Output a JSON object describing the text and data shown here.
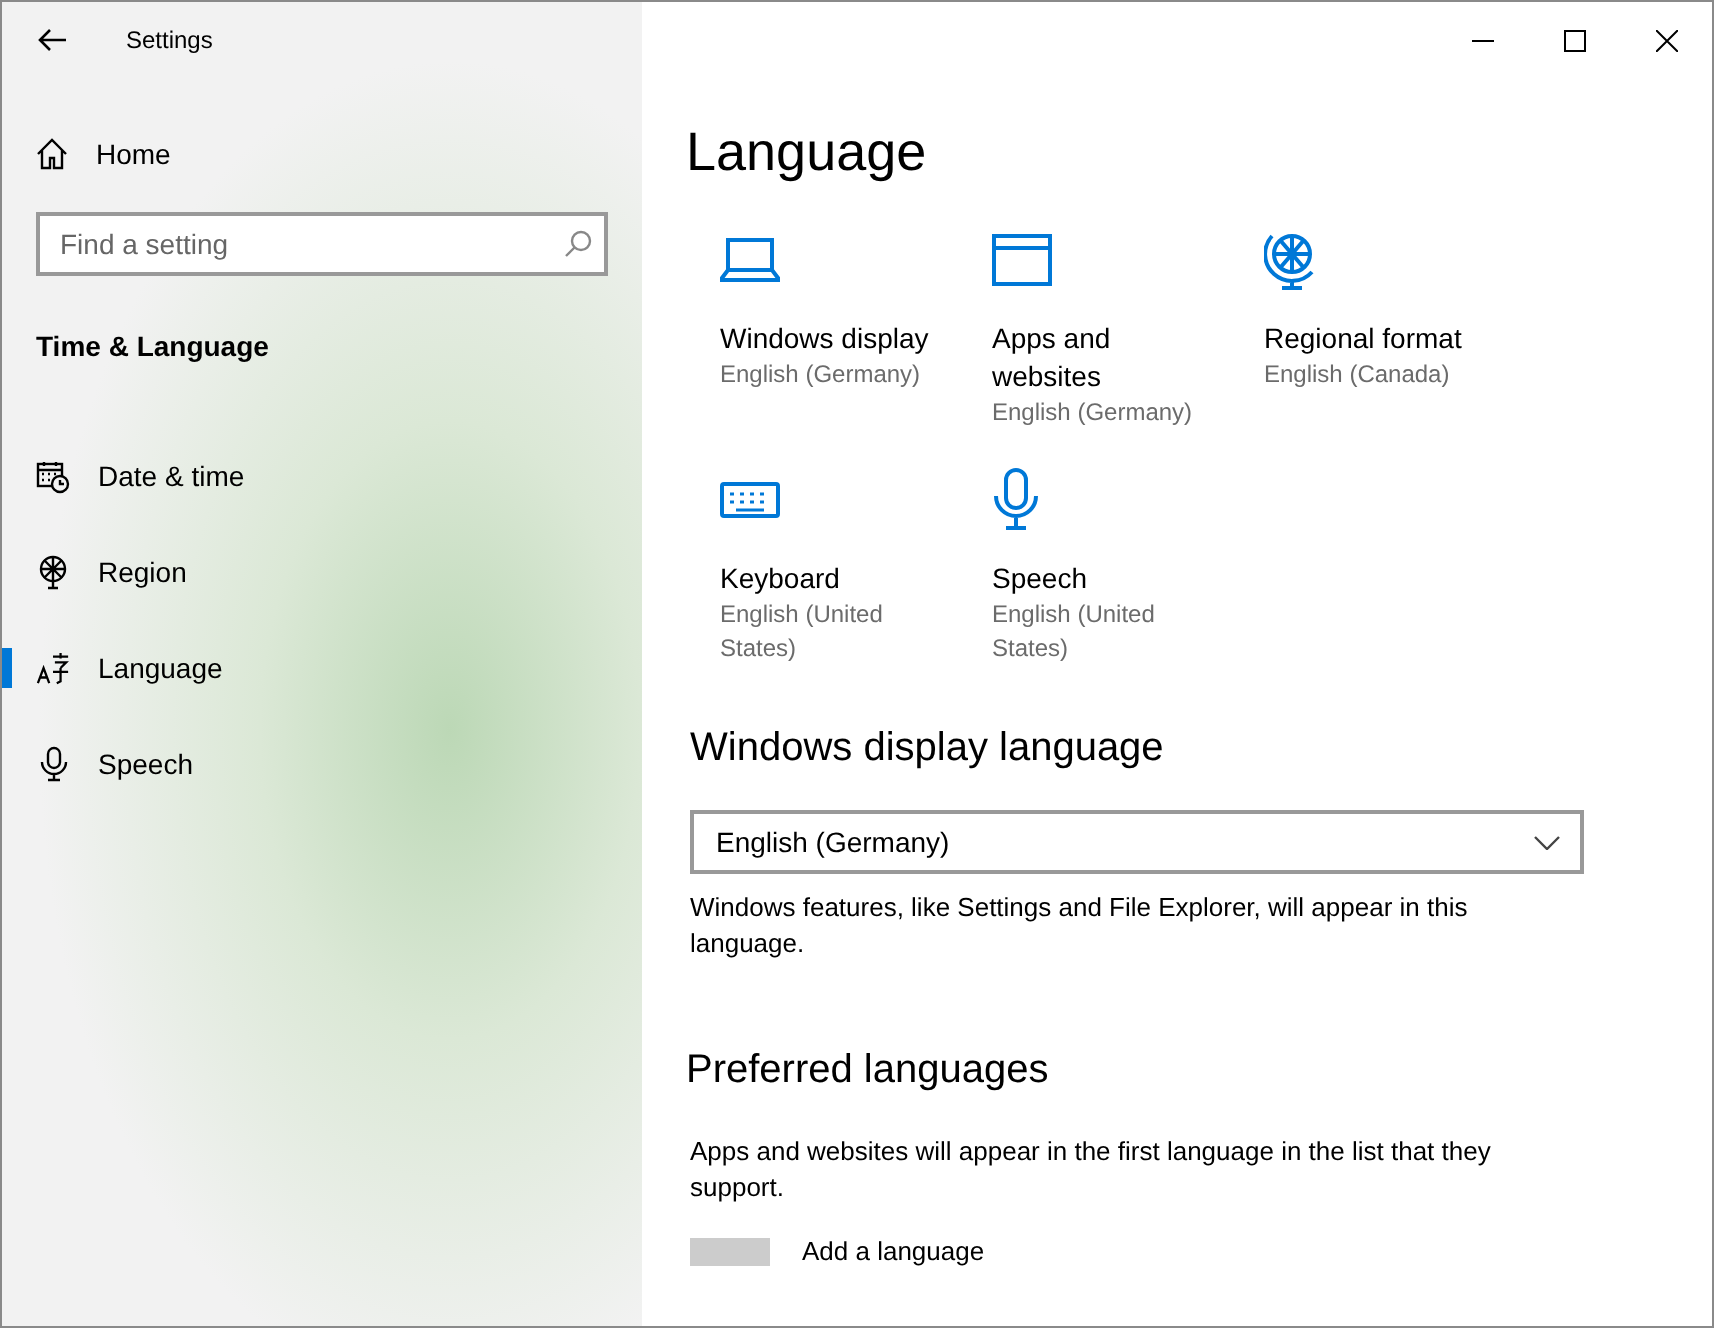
{
  "window": {
    "title": "Settings"
  },
  "sidebar": {
    "home": "Home",
    "search": {
      "placeholder": "Find a setting"
    },
    "section": "Time & Language",
    "items": [
      {
        "kind": "calendar",
        "label": "Date & time",
        "selected": false
      },
      {
        "kind": "globe",
        "label": "Region",
        "selected": false
      },
      {
        "kind": "language",
        "label": "Language",
        "selected": true
      },
      {
        "kind": "mic",
        "label": "Speech",
        "selected": false
      }
    ]
  },
  "page": {
    "title": "Language",
    "tiles": [
      {
        "kind": "laptop",
        "label": "Windows display",
        "value": "English (Germany)"
      },
      {
        "kind": "window",
        "label": "Apps and websites",
        "value": "English (Germany)"
      },
      {
        "kind": "globe",
        "label": "Regional format",
        "value": "English (Canada)"
      },
      {
        "kind": "keyboard",
        "label": "Keyboard",
        "value": "English (United States)"
      },
      {
        "kind": "mic",
        "label": "Speech",
        "value": "English (United States)"
      }
    ],
    "display_language": {
      "heading": "Windows display language",
      "value": "English (Germany)",
      "note": "Windows features, like Settings and File Explorer, will appear in this language."
    },
    "preferred": {
      "heading": "Preferred languages",
      "note": "Apps and websites will appear in the first language in the list that they support.",
      "add": "Add a language"
    }
  }
}
